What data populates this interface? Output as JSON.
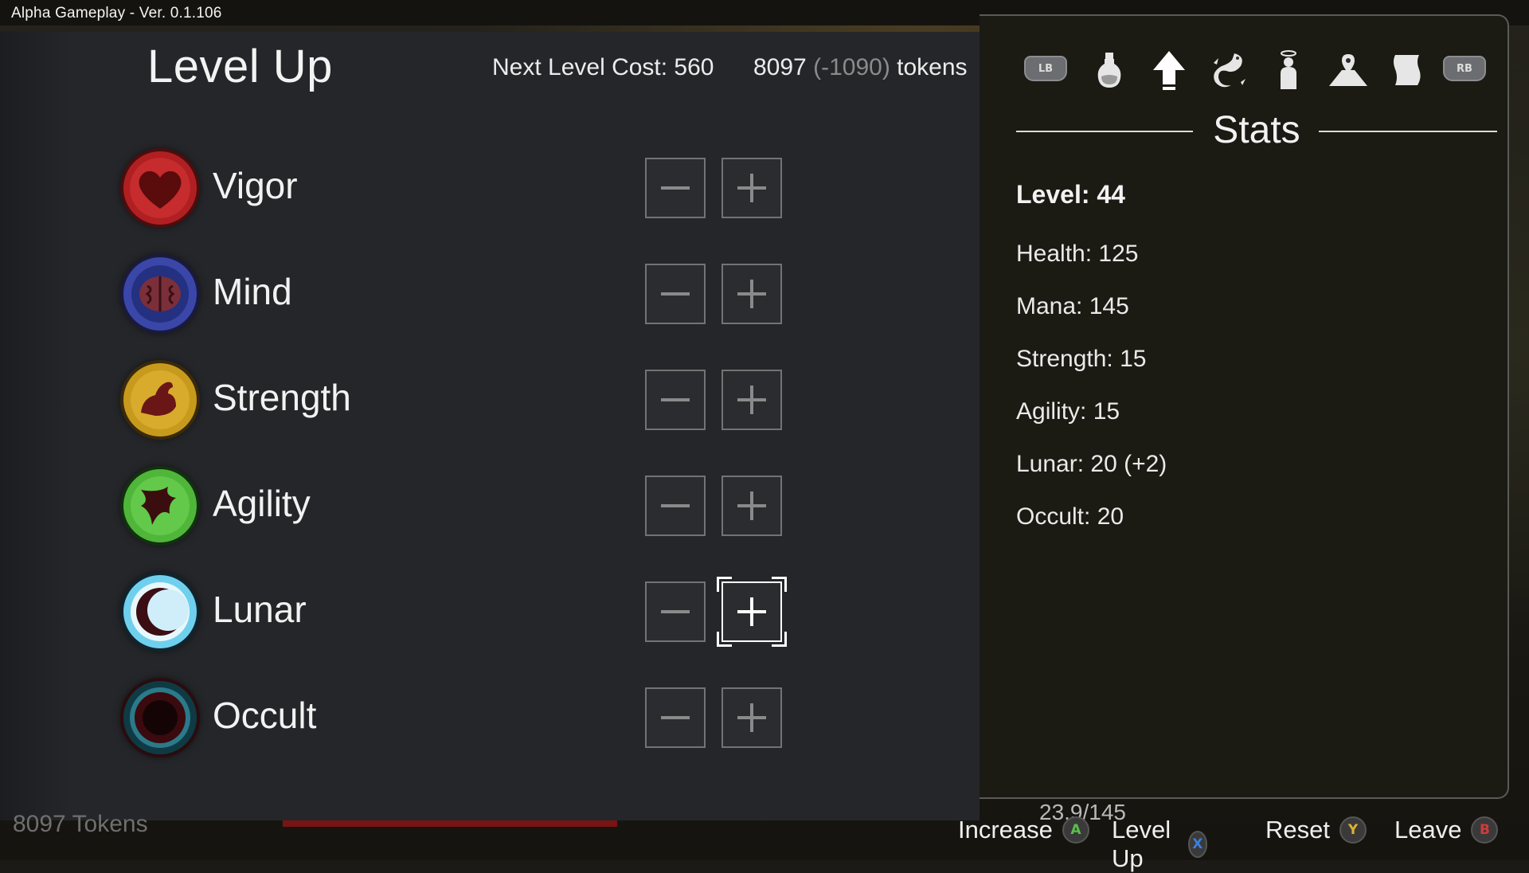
{
  "window": {
    "build_label": "Alpha Gameplay - Ver. 0.1.106"
  },
  "level_up": {
    "title": "Level Up",
    "next_level_cost": "Next Level Cost: 560",
    "tokens_value": "8097",
    "tokens_delta": "(-1090)",
    "tokens_unit": "tokens",
    "attributes": [
      {
        "label": "Vigor",
        "icon": "heart-icon"
      },
      {
        "label": "Mind",
        "icon": "brain-icon"
      },
      {
        "label": "Strength",
        "icon": "flexed-arm-icon"
      },
      {
        "label": "Agility",
        "icon": "winged-icon"
      },
      {
        "label": "Lunar",
        "icon": "crescent-moon-icon",
        "selected": true
      },
      {
        "label": "Occult",
        "icon": "dark-orb-icon"
      }
    ]
  },
  "stats_panel": {
    "bumper_left": "LB",
    "bumper_right": "RB",
    "tabs": [
      "potion-icon",
      "level-up-arrow-icon",
      "dragon-icon",
      "halo-figure-icon",
      "map-marker-icon",
      "scroll-icon"
    ],
    "heading": "Stats",
    "level": "Level: 44",
    "lines": [
      "Health: 125",
      "Mana: 145",
      "Strength: 15",
      "Agility: 15",
      "Lunar: 20 (+2)",
      "Occult: 20"
    ]
  },
  "hud": {
    "tokens": "8097 Tokens",
    "mana": "23.9/145"
  },
  "hints": [
    {
      "label": "Increase",
      "button": "A",
      "color": "#5bbf4a"
    },
    {
      "label": "Level Up",
      "button": "X",
      "color": "#3b7fd9"
    },
    {
      "label": "Reset",
      "button": "Y",
      "color": "#e0b030"
    },
    {
      "label": "Leave",
      "button": "B",
      "color": "#d23a3a"
    }
  ]
}
